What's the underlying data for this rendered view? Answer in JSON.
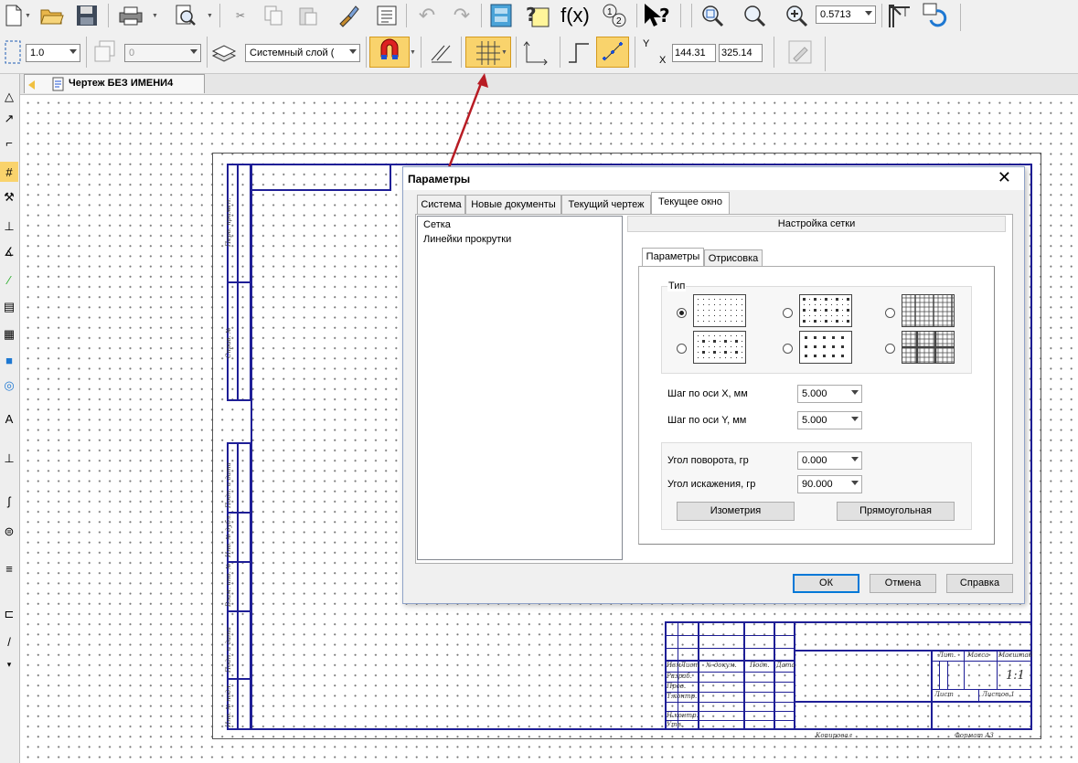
{
  "toolbar1": {
    "zoom_value": "0.5713",
    "icons": [
      "new-document",
      "open-folder",
      "save",
      "print",
      "preview",
      "cut",
      "copy",
      "paste",
      "format-painter",
      "properties-list",
      "undo",
      "redo",
      "manager",
      "help-sheet",
      "function-fx",
      "numbering",
      "whats-this",
      "zoom-window",
      "zoom-out",
      "zoom-in",
      "zoom-combo",
      "crane",
      "refresh"
    ]
  },
  "toolbar2": {
    "scale_value": "1.0",
    "line_style_value": "0",
    "layer_value": "Системный слой (",
    "x_coord": "144.31",
    "y_coord": "325.14",
    "x_label": "X",
    "y_label": "Y"
  },
  "document_tab": {
    "title": "Чертеж БЕЗ ИМЕНИ4"
  },
  "dialog": {
    "title": "Параметры",
    "close_glyph": "✕",
    "tabs": [
      "Система",
      "Новые документы",
      "Текущий чертеж",
      "Текущее окно"
    ],
    "selected_tab": "Текущее окно",
    "tree_items": [
      "Сетка",
      "Линейки прокрутки"
    ],
    "section_header": "Настройка сетки",
    "subtabs": [
      "Параметры",
      "Отрисовка"
    ],
    "type_group_label": "Тип",
    "selected_grid_type": 0,
    "step_x_label": "Шаг по оси X, мм",
    "step_x_value": "5.000",
    "step_y_label": "Шаг по оси Y, мм",
    "step_y_value": "5.000",
    "rotation_label": "Угол поворота, гр",
    "rotation_value": "0.000",
    "skew_label": "Угол искажения, гр",
    "skew_value": "90.000",
    "isometry_button": "Изометрия",
    "rectangular_button": "Прямоугольная",
    "ok_button": "ОК",
    "cancel_button": "Отмена",
    "help_button": "Справка"
  },
  "drawing_stamp": {
    "bottom_left_labels": [
      "Изм",
      "Лист",
      "№ докум.",
      "Подп.",
      "Дата",
      "Разраб.",
      "Пров.",
      "Т.контр.",
      "Н.контр.",
      "Утв."
    ],
    "lit_label": "Лит.",
    "mass_label": "Масса",
    "scale_label": "Масштаб",
    "scale_value": "1:1",
    "sheet_label": "Лист",
    "sheets_label": "Листов 1",
    "copied_label": "Копировал",
    "format_label": "Формат A3",
    "left_strip_labels": [
      "Перв. примен.",
      "Справ. №",
      "Подп. и дата",
      "Инв. № дубл.",
      "Взам. инв. №",
      "Подп. и дата",
      "Инв. № подл."
    ]
  },
  "colors": {
    "frame_blue": "#1e1e96",
    "active_button": "#f9d36c",
    "arrow_red": "#b81c24"
  }
}
